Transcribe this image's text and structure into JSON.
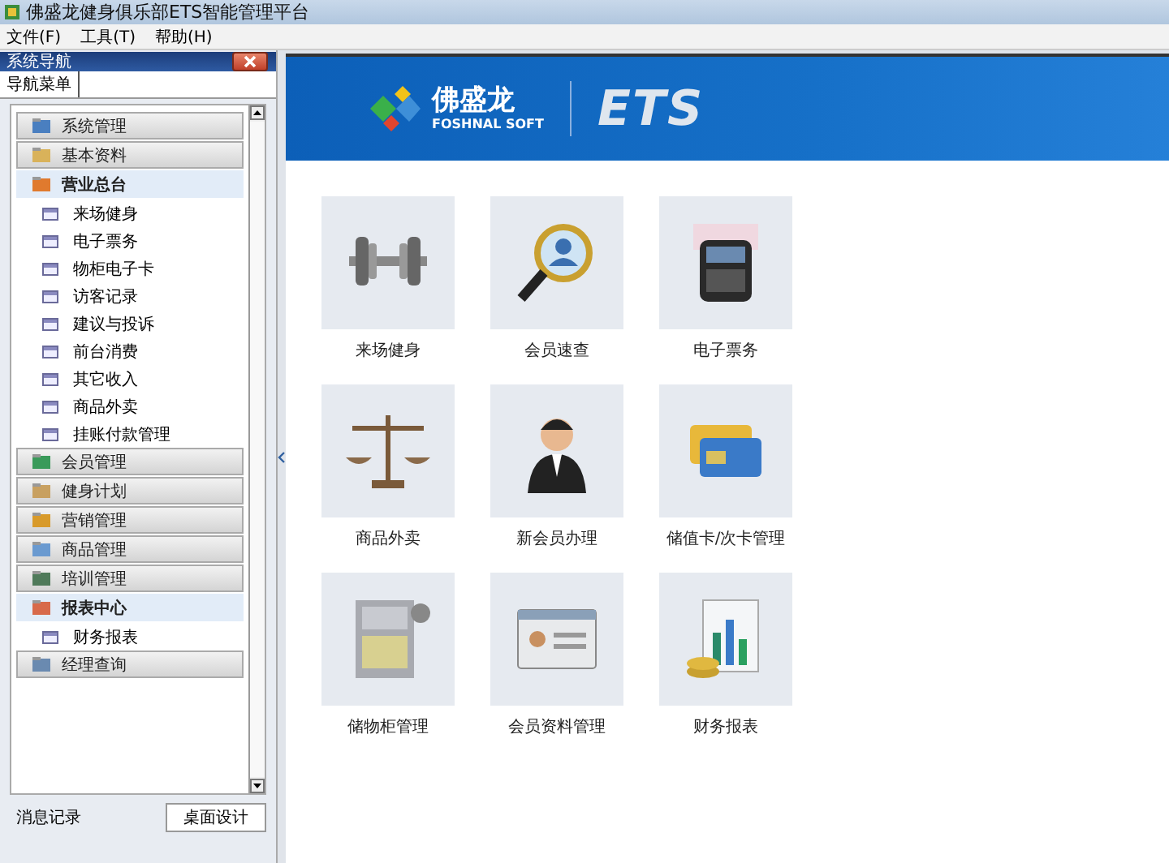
{
  "window": {
    "title": "佛盛龙健身俱乐部ETS智能管理平台"
  },
  "menu": [
    "文件(F)",
    "工具(T)",
    "帮助(H)"
  ],
  "nav_panel": {
    "title": "系统导航",
    "tab": "导航菜单",
    "sections": [
      {
        "label": "系统管理",
        "expanded": false
      },
      {
        "label": "基本资料",
        "expanded": false
      },
      {
        "label": "营业总台",
        "expanded": true,
        "children": [
          "来场健身",
          "电子票务",
          "物柜电子卡",
          "访客记录",
          "建议与投诉",
          "前台消费",
          "其它收入",
          "商品外卖",
          "挂账付款管理"
        ]
      },
      {
        "label": "会员管理",
        "expanded": false
      },
      {
        "label": "健身计划",
        "expanded": false
      },
      {
        "label": "营销管理",
        "expanded": false
      },
      {
        "label": "商品管理",
        "expanded": false
      },
      {
        "label": "培训管理",
        "expanded": false
      },
      {
        "label": "报表中心",
        "expanded": true,
        "children": [
          "财务报表"
        ]
      },
      {
        "label": "经理查询",
        "expanded": false
      }
    ],
    "bottom_tabs": [
      {
        "label": "消息记录",
        "selected": false
      },
      {
        "label": "桌面设计",
        "selected": true
      }
    ]
  },
  "banner": {
    "brand": "佛盛龙",
    "brand_sub": "FOSHNAL SOFT",
    "product": "ETS"
  },
  "tiles": [
    "来场健身",
    "会员速查",
    "电子票务",
    "商品外卖",
    "新会员办理",
    "储值卡/次卡管理",
    "储物柜管理",
    "会员资料管理",
    "财务报表"
  ]
}
